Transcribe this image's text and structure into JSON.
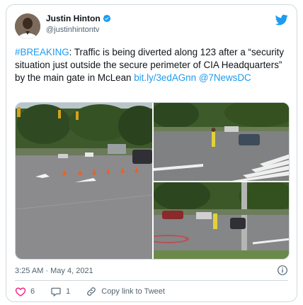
{
  "author": {
    "name": "Justin Hinton",
    "handle": "@justinhintontv"
  },
  "tweet": {
    "hashtag": "#BREAKING",
    "body": ": Traffic is being diverted along 123 after a “security situation just outside the secure perimeter of CIA Headquarters” by the main gate in McLean ",
    "link_text": "bit.ly/3edAGnn",
    "mention": "@7NewsDC"
  },
  "media": {
    "count": 3
  },
  "meta": {
    "timestamp": "3:25 AM · May 4, 2021"
  },
  "actions": {
    "likes": "6",
    "replies": "1",
    "copy_link_label": "Copy link to Tweet"
  },
  "colors": {
    "accent": "#1d9bf0",
    "like": "#f91880",
    "verified": "#1d9bf0",
    "text": "#0f1419",
    "muted": "#536471"
  },
  "icons": {
    "brand": "twitter-bird-icon",
    "verified": "verified-badge-icon",
    "info": "info-icon",
    "like": "heart-icon",
    "reply": "speech-bubble-icon",
    "copy": "link-icon"
  }
}
